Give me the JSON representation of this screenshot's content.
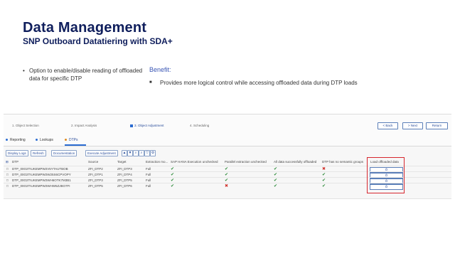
{
  "header": {
    "title": "Data Management",
    "subtitle": "SNP Outboard Datatiering with SDA+"
  },
  "left_bullet": "Option to enable/disable reading of offloaded data for specific DTP",
  "benefit": {
    "label": "Benefit:",
    "bullet": "Provides more logical control while accessing offloaded data during DTP loads"
  },
  "app": {
    "steps": [
      "1. Object Selection",
      "2. Impact Analysis",
      "3. Object Adjustment",
      "4. Scheduling"
    ],
    "active_step": 2,
    "nav": {
      "back": "< Back",
      "next": "> Next",
      "return": "Return"
    },
    "tabs": [
      "Reporting",
      "Lookups",
      "DTPs"
    ],
    "active_tab": 2,
    "tab_colors": [
      "#2a6bd1",
      "#2a6bd1",
      "#e08a1e"
    ],
    "toolbar": [
      "Display Logs",
      "Refresh",
      "Documentation",
      "Execute Adjustment"
    ],
    "toolbar_icons": [
      "sort-asc-icon",
      "sort-desc-icon",
      "find-icon",
      "find-next-icon",
      "filter-icon",
      "settings-icon"
    ],
    "table": {
      "columns": [
        "DTP",
        "Source",
        "Target",
        "Extraction mo...",
        "SAP HANA Execution unchecked",
        "Parallel extraction unchecked",
        "All data successfully offloaded",
        "DTP has no semantic groups",
        "Load offloaded data"
      ],
      "rows": [
        {
          "dtp": "DTP_00O2TIUKEMPW2V5YTAUTBOB",
          "source": "ZFI_DTP2",
          "target": "ZFI_DTP3",
          "mode": "Full",
          "hana": true,
          "parallel": true,
          "offloaded": true,
          "semantic": false,
          "load": "Ô"
        },
        {
          "dtp": "DTP_00O2TIUKEMPW2W25S6CPVOPY",
          "source": "ZFI_DTP1",
          "target": "ZFI_DTP4",
          "mode": "Full",
          "hana": true,
          "parallel": true,
          "offloaded": true,
          "semantic": true,
          "load": "Ô"
        },
        {
          "dtp": "DTP_00O2TIUKEMPW2WH6OTK7M3B1",
          "source": "ZFI_DTP3",
          "target": "ZFI_DTP5",
          "mode": "Full",
          "hana": true,
          "parallel": true,
          "offloaded": true,
          "semantic": true,
          "load": "Ô"
        },
        {
          "dtp": "DTP_00O2TIUKEMPW2WHW5ZJBO7FI",
          "source": "ZFI_DTP5",
          "target": "ZFI_DTP6",
          "mode": "Full",
          "hana": true,
          "parallel": false,
          "offloaded": true,
          "semantic": true,
          "load": "Ô"
        }
      ]
    }
  }
}
